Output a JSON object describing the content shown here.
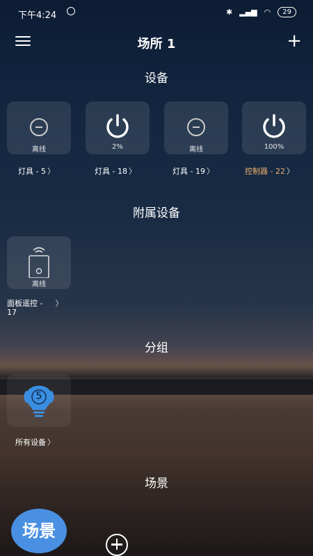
{
  "status_bar": {
    "time": "下午4:24",
    "battery": "29"
  },
  "header": {
    "title": "场所 1"
  },
  "sections": {
    "devices": "设备",
    "accessories": "附属设备",
    "groups": "分组",
    "scenes": "场景"
  },
  "devices": [
    {
      "status": "离线",
      "label": "灯具 - 5",
      "icon": "offline-icon"
    },
    {
      "status": "2%",
      "label": "灯具 - 18",
      "icon": "power-icon"
    },
    {
      "status": "离线",
      "label": "灯具 - 19",
      "icon": "offline-icon"
    },
    {
      "status": "100%",
      "label": "控制器 - 22",
      "icon": "power-icon",
      "label_color": "#f0b070"
    }
  ],
  "accessories": [
    {
      "status": "离线",
      "label": "面板遥控 -",
      "label_line2": "17",
      "icon": "wall-switch-icon"
    }
  ],
  "groups": [
    {
      "label": "所有设备",
      "count": "5",
      "icon": "bulb-icon",
      "color": "#3a8ee0"
    }
  ],
  "fab": {
    "label": "场景"
  }
}
